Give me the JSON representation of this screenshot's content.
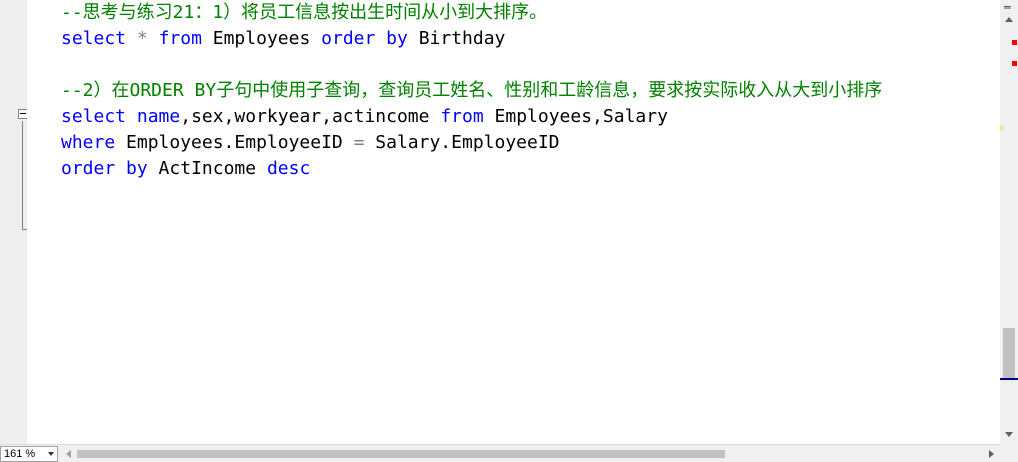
{
  "editor": {
    "lines": [
      {
        "segments": [
          {
            "text": "--思考与练习21：1）将员工信息按出生时间从小到大排序。",
            "type": "cm"
          }
        ]
      },
      {
        "segments": [
          {
            "text": "select",
            "type": "kw"
          },
          {
            "text": " ",
            "type": "tx"
          },
          {
            "text": "*",
            "type": "op"
          },
          {
            "text": " ",
            "type": "tx"
          },
          {
            "text": "from",
            "type": "kw"
          },
          {
            "text": " Employees ",
            "type": "tx"
          },
          {
            "text": "order",
            "type": "kw"
          },
          {
            "text": " ",
            "type": "tx"
          },
          {
            "text": "by",
            "type": "kw"
          },
          {
            "text": " Birthday",
            "type": "tx"
          }
        ]
      },
      {
        "segments": []
      },
      {
        "segments": [
          {
            "text": "--2）在ORDER BY子句中使用子查询，查询员工姓名、性别和工龄信息，要求按实际收入从大到小排序",
            "type": "cm"
          }
        ]
      },
      {
        "segments": [
          {
            "text": "select",
            "type": "kw"
          },
          {
            "text": " ",
            "type": "tx"
          },
          {
            "text": "name",
            "type": "kw"
          },
          {
            "text": ",sex,workyear,actincome ",
            "type": "tx"
          },
          {
            "text": "from",
            "type": "kw"
          },
          {
            "text": " Employees,Salary",
            "type": "tx"
          }
        ]
      },
      {
        "segments": [
          {
            "text": "where",
            "type": "kw"
          },
          {
            "text": " Employees.EmployeeID ",
            "type": "tx"
          },
          {
            "text": "=",
            "type": "op"
          },
          {
            "text": " Salary.EmployeeID",
            "type": "tx"
          }
        ]
      },
      {
        "segments": [
          {
            "text": "order",
            "type": "kw"
          },
          {
            "text": " ",
            "type": "tx"
          },
          {
            "text": "by",
            "type": "kw"
          },
          {
            "text": " ActIncome ",
            "type": "tx"
          },
          {
            "text": "desc",
            "type": "kw"
          }
        ]
      }
    ],
    "colors": {
      "keyword": "#0000ff",
      "comment": "#008000",
      "operator": "#808080",
      "text": "#000000"
    }
  },
  "statusbar": {
    "zoom_value": "161 %"
  },
  "scrollbar_markers": {
    "error_color": "#ff0000",
    "warning_color": "#f5e56b"
  },
  "icons": [
    "split-window-icon",
    "scroll-up-icon",
    "scroll-down-icon",
    "scroll-left-icon",
    "scroll-right-icon",
    "dropdown-chevron-icon",
    "fold-collapse-icon"
  ]
}
